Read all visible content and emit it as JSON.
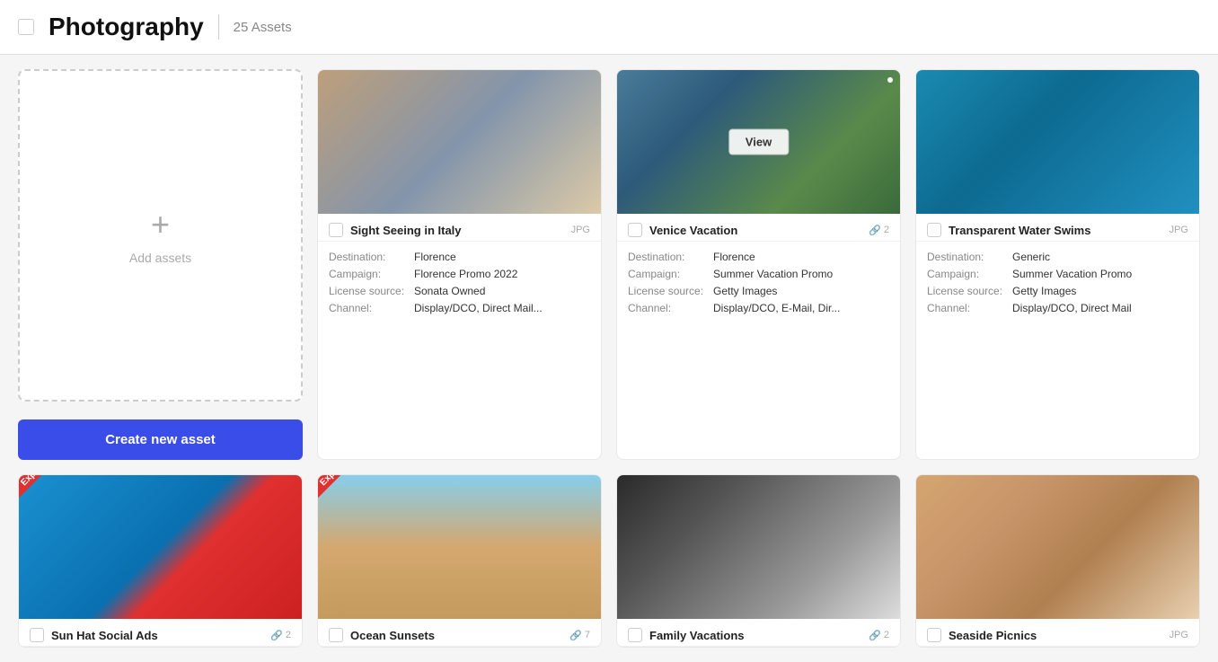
{
  "header": {
    "title": "Photography",
    "asset_count": "25 Assets"
  },
  "add_card": {
    "label": "Add assets",
    "create_button": "Create new asset"
  },
  "assets": [
    {
      "id": "sight-seeing-italy",
      "title": "Sight Seeing in Italy",
      "type": "JPG",
      "attachment_count": null,
      "expired": false,
      "hovered": false,
      "image_class": "img-italy",
      "details": {
        "destination_label": "Destination:",
        "destination_value": "Florence",
        "campaign_label": "Campaign:",
        "campaign_value": "Florence Promo 2022",
        "license_label": "License source:",
        "license_value": "Sonata Owned",
        "channel_label": "Channel:",
        "channel_value": "Display/DCO, Direct Mail..."
      }
    },
    {
      "id": "venice-vacation",
      "title": "Venice Vacation",
      "type": null,
      "attachment_count": "2",
      "expired": false,
      "hovered": true,
      "image_class": "img-venice",
      "details": {
        "destination_label": "Destination:",
        "destination_value": "Florence",
        "campaign_label": "Campaign:",
        "campaign_value": "Summer Vacation Promo",
        "license_label": "License source:",
        "license_value": "Getty Images",
        "channel_label": "Channel:",
        "channel_value": "Display/DCO, E-Mail, Dir..."
      }
    },
    {
      "id": "transparent-water-swims",
      "title": "Transparent Water Swims",
      "type": "JPG",
      "attachment_count": null,
      "expired": false,
      "hovered": false,
      "image_class": "img-water",
      "details": {
        "destination_label": "Destination:",
        "destination_value": "Generic",
        "campaign_label": "Campaign:",
        "campaign_value": "Summer Vacation Promo",
        "license_label": "License source:",
        "license_value": "Getty Images",
        "channel_label": "Channel:",
        "channel_value": "Display/DCO, Direct Mail"
      }
    }
  ],
  "assets_row2": [
    {
      "id": "sun-hat-social-ads",
      "title": "Sun Hat Social Ads",
      "type": null,
      "attachment_count": "2",
      "expired": true,
      "image_class": "img-sunhat"
    },
    {
      "id": "ocean-sunsets",
      "title": "Ocean Sunsets",
      "type": null,
      "attachment_count": "7",
      "expired": true,
      "image_class": "img-ocean"
    },
    {
      "id": "family-vacations",
      "title": "Family Vacations",
      "type": null,
      "attachment_count": "2",
      "expired": false,
      "image_class": "img-family"
    },
    {
      "id": "seaside-picnics",
      "title": "Seaside Picnics",
      "type": "JPG",
      "attachment_count": null,
      "expired": false,
      "image_class": "img-seaside"
    }
  ],
  "view_overlay_label": "View",
  "expired_label": "Expired",
  "attachment_icon": "🔗",
  "detail_labels": {
    "destination": "Destination:",
    "campaign": "Campaign:",
    "license": "License source:",
    "channel": "Channel:"
  }
}
